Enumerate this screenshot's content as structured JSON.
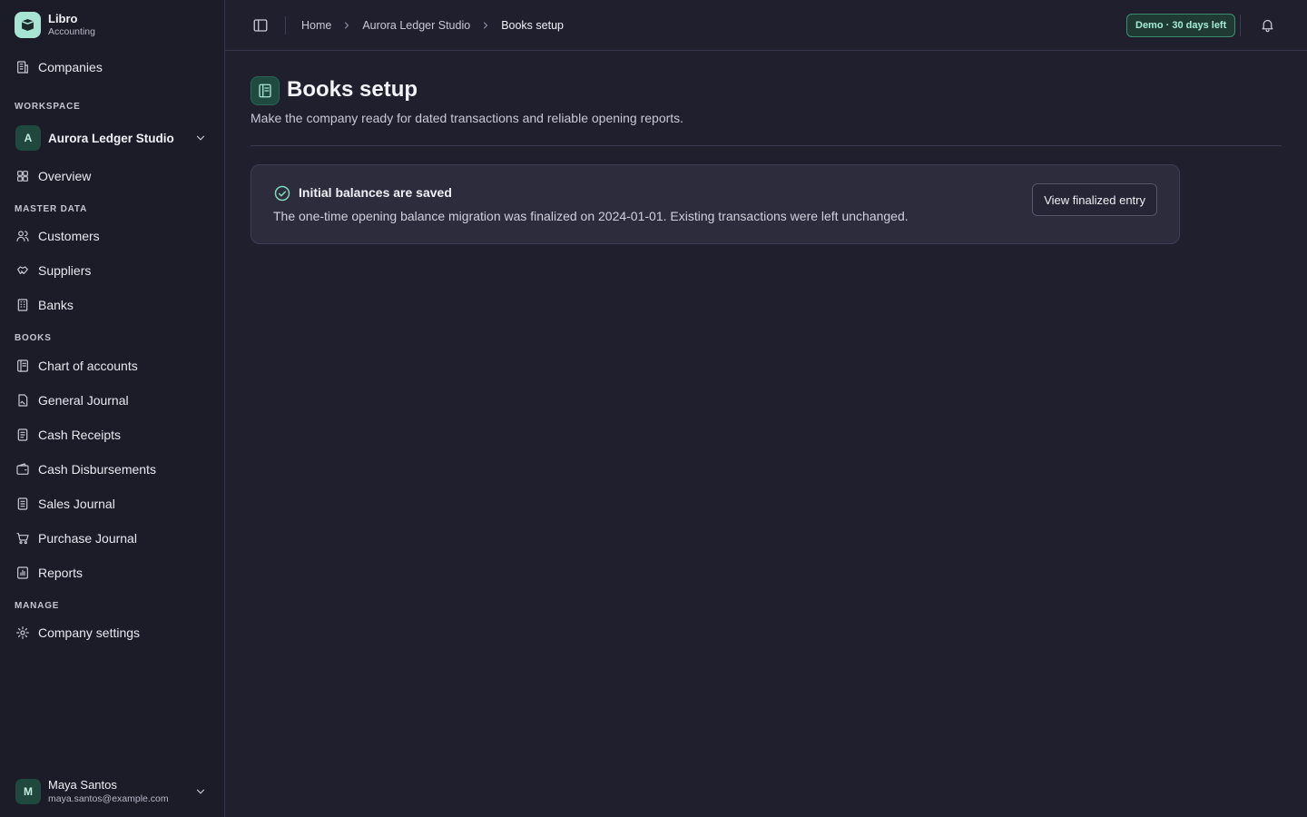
{
  "brand": {
    "name": "Libro",
    "subtitle": "Accounting"
  },
  "nav": {
    "companies": "Companies",
    "workspace_label": "WORKSPACE",
    "workspace": {
      "initial": "A",
      "name": "Aurora Ledger Studio"
    },
    "overview": "Overview",
    "master_data_label": "MASTER DATA",
    "customers": "Customers",
    "suppliers": "Suppliers",
    "banks": "Banks",
    "books_label": "BOOKS",
    "chart_of_accounts": "Chart of accounts",
    "general_journal": "General Journal",
    "cash_receipts": "Cash Receipts",
    "cash_disbursements": "Cash Disbursements",
    "sales_journal": "Sales Journal",
    "purchase_journal": "Purchase Journal",
    "reports": "Reports",
    "manage_label": "MANAGE",
    "company_settings": "Company settings"
  },
  "user": {
    "initial": "M",
    "name": "Maya Santos",
    "email": "maya.santos@example.com"
  },
  "topbar": {
    "breadcrumb": [
      "Home",
      "Aurora Ledger Studio",
      "Books setup"
    ],
    "demo_badge": "Demo · 30 days left"
  },
  "page": {
    "title": "Books setup",
    "subtitle": "Make the company ready for dated transactions and reliable opening reports."
  },
  "status_card": {
    "title": "Initial balances are saved",
    "text": "The one-time opening balance migration was finalized on 2024-01-01. Existing transactions were left unchanged.",
    "button": "View finalized entry"
  },
  "colors": {
    "accent": "#a8e4d4",
    "background": "#1f1f2e",
    "sidebar": "#1c1c29",
    "success": "#7fd8b8"
  },
  "icons": {
    "brand": "book-box-icon",
    "companies": "building-icon",
    "overview": "grid-icon",
    "customers": "users-icon",
    "suppliers": "handshake-icon",
    "banks": "bank-icon",
    "chart_of_accounts": "ledger-icon",
    "general_journal": "journal-icon",
    "cash_receipts": "receipt-icon",
    "cash_disbursements": "wallet-icon",
    "sales_journal": "list-icon",
    "purchase_journal": "cart-icon",
    "reports": "chart-icon",
    "company_settings": "gear-icon",
    "notifications": "bell-icon",
    "status": "check-circle-icon"
  }
}
